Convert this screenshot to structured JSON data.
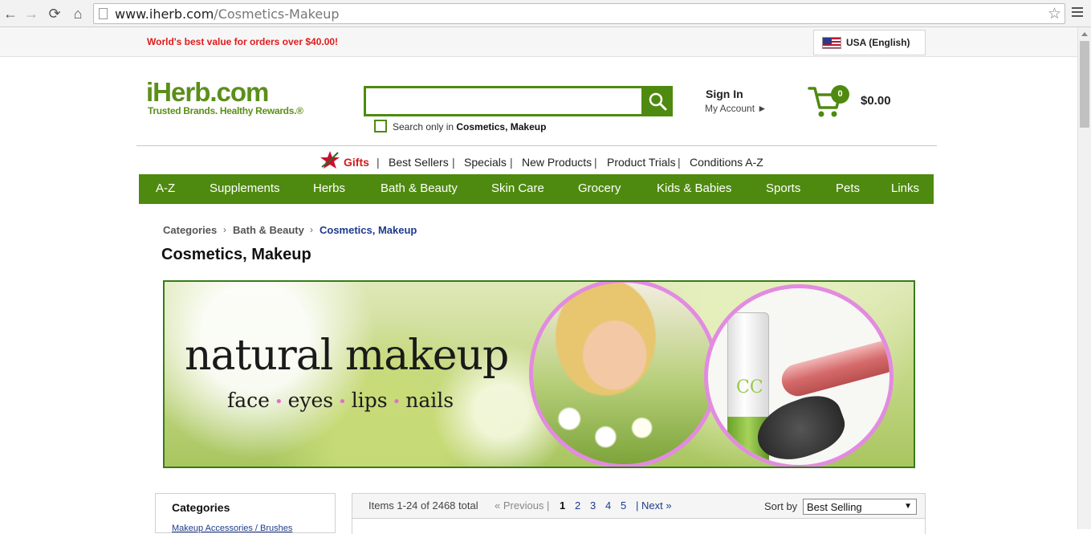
{
  "browser": {
    "back": "←",
    "forward": "→",
    "reload": "⟳",
    "home": "⌂",
    "url_host": "www.iherb.com",
    "url_path": "/Cosmetics-Makeup",
    "star": "☆"
  },
  "topbar": {
    "promo": "World's best value for orders over $40.00!",
    "locale": "USA (English)"
  },
  "header": {
    "logo": "iHerb.com",
    "tagline": "Trusted Brands. Healthy Rewards.®",
    "search_placeholder": "",
    "search_only_prefix": "Search only in ",
    "search_only_scope": "Cosmetics, Makeup",
    "sign_in": "Sign In",
    "my_account": "My Account ►",
    "cart_count": "0",
    "cart_total": "$0.00"
  },
  "sublinks": [
    "Gifts",
    "Best Sellers",
    "Specials",
    "New Products",
    "Product Trials",
    "Conditions A-Z"
  ],
  "separator": "|",
  "nav": [
    "A-Z",
    "Supplements",
    "Herbs",
    "Bath & Beauty",
    "Skin Care",
    "Grocery",
    "Kids & Babies",
    "Sports",
    "Pets",
    "Links"
  ],
  "breadcrumb": {
    "items": [
      "Categories",
      "Bath & Beauty",
      "Cosmetics, Makeup"
    ],
    "arrow": "›"
  },
  "page_title": "Cosmetics, Makeup",
  "banner": {
    "title": "natural makeup",
    "subtitle": [
      "face",
      "eyes",
      "lips",
      "nails"
    ],
    "dot": "•",
    "tube_text": "CC"
  },
  "categories": {
    "title": "Categories",
    "first_link": "Makeup Accessories / Brushes"
  },
  "listing": {
    "items_count": "Items 1-24 of 2468 total",
    "previous": "« Previous |",
    "pages": [
      "1",
      "2",
      "3",
      "4",
      "5"
    ],
    "next": "| Next »",
    "sort_label": "Sort by",
    "sort_value": "Best Selling",
    "sort_arrow": "▼"
  },
  "colors": {
    "brand_green": "#4f8a10",
    "promo_red": "#e01b1b",
    "link_blue": "#1d3b8c",
    "banner_circle": "#e28be0"
  }
}
